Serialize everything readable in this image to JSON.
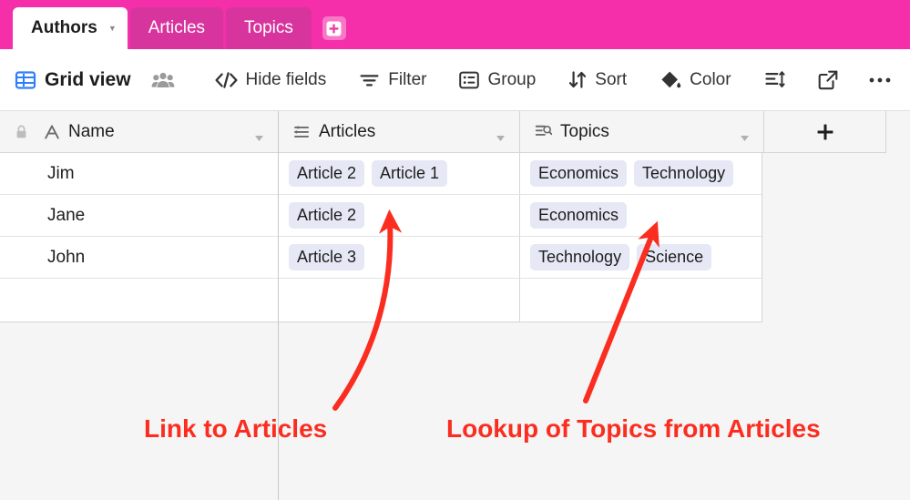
{
  "tabs": {
    "items": [
      {
        "label": "Authors",
        "active": true,
        "has_caret": true
      },
      {
        "label": "Articles",
        "active": false,
        "has_caret": false
      },
      {
        "label": "Topics",
        "active": false,
        "has_caret": false
      }
    ],
    "add_tab_icon": "plus-square-icon",
    "bar_color": "#f52faa",
    "inactive_tab_color": "#d8349e"
  },
  "toolbar": {
    "grid_view_label": "Grid view",
    "grid_view_icon": "grid-table-icon",
    "grid_view_icon_color": "#2d7ff9",
    "collaborators_icon": "people-group-icon",
    "hide_fields_label": "Hide fields",
    "hide_fields_icon": "code-slash-icon",
    "filter_label": "Filter",
    "filter_icon": "funnel-lines-icon",
    "group_label": "Group",
    "group_icon": "group-list-icon",
    "sort_label": "Sort",
    "sort_icon": "sort-arrows-icon",
    "color_label": "Color",
    "color_icon": "paint-bucket-icon",
    "row_height_icon": "row-height-icon",
    "share_icon": "share-export-icon",
    "more_icon": "ellipsis-icon"
  },
  "grid": {
    "columns": [
      {
        "name": "Name",
        "icon": "text-field-a-icon",
        "locked": true,
        "caret": true
      },
      {
        "name": "Articles",
        "icon": "link-record-icon",
        "locked": false,
        "caret": true
      },
      {
        "name": "Topics",
        "icon": "lookup-search-icon",
        "locked": false,
        "caret": true
      }
    ],
    "add_field_icon": "plus-icon",
    "chip_color": "#e6e9f5",
    "rows": [
      {
        "name": "Jim",
        "articles": [
          "Article 2",
          "Article 1"
        ],
        "topics": [
          "Economics",
          "Technology"
        ]
      },
      {
        "name": "Jane",
        "articles": [
          "Article 2"
        ],
        "topics": [
          "Economics"
        ]
      },
      {
        "name": "John",
        "articles": [
          "Article 3"
        ],
        "topics": [
          "Technology",
          "Science"
        ]
      }
    ],
    "empty_row": {
      "name": "",
      "articles": [],
      "topics": []
    }
  },
  "annotations": {
    "color": "#fa2d20",
    "link_label": "Link to Articles",
    "lookup_label": "Lookup of Topics from Articles",
    "link_arrow": "curved-arrow-up",
    "lookup_arrow": "straight-arrow-up-right"
  }
}
